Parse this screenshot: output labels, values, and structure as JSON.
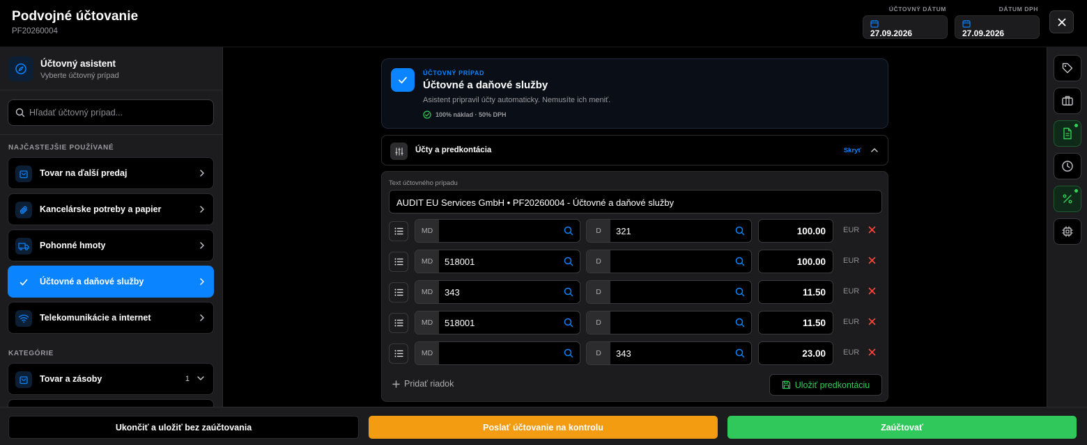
{
  "header": {
    "title": "Podvojné účtovanie",
    "doc_number": "PF20260004",
    "accounting_date_label": "ÚČTOVNÝ DÁTUM",
    "accounting_date": "27.09.2026",
    "vat_date_label": "DÁTUM DPH",
    "vat_date": "27.09.2026"
  },
  "assistant": {
    "title": "Účtovný asistent",
    "subtitle": "Vyberte účtovný prípad",
    "search_placeholder": "Hľadať účtovný prípad..."
  },
  "sidebar": {
    "frequent_label": "NAJČASTEJŠIE POUŽÍVANÉ",
    "frequent_items": [
      {
        "label": "Tovar na ďalší predaj",
        "icon": "shopping-bag-icon"
      },
      {
        "label": "Kancelárske potreby a papier",
        "icon": "paperclip-icon"
      },
      {
        "label": "Pohonné hmoty",
        "icon": "truck-icon"
      },
      {
        "label": "Účtovné a daňové služby",
        "icon": "check-icon",
        "active": true
      },
      {
        "label": "Telekomunikácie a internet",
        "icon": "wifi-icon"
      }
    ],
    "categories_label": "KATEGÓRIE",
    "categories": [
      {
        "label": "Tovar a zásoby",
        "count": "1",
        "icon": "shopping-bag-icon"
      }
    ]
  },
  "case": {
    "overline": "ÚČTOVNÝ PRÍPAD",
    "title": "Účtovné a daňové služby",
    "description": "Asistent pripravil účty automaticky. Nemusíte ich meniť.",
    "badge": "100% náklad · 50% DPH"
  },
  "accounts_section": {
    "title": "Účty a predkontácia",
    "toggle_label": "Skryť"
  },
  "entries": {
    "text_label": "Text účtovného prípadu",
    "text_value": "AUDIT EU Services GmbH • PF20260004 - Účtovné a daňové služby",
    "md_label": "MD",
    "d_label": "D",
    "currency": "EUR",
    "rows": [
      {
        "md": "",
        "d": "321",
        "amount": "100.00"
      },
      {
        "md": "518001",
        "d": "",
        "amount": "100.00"
      },
      {
        "md": "343",
        "d": "",
        "amount": "11.50"
      },
      {
        "md": "518001",
        "d": "",
        "amount": "11.50"
      },
      {
        "md": "",
        "d": "343",
        "amount": "23.00"
      }
    ],
    "add_row_label": "Pridať riadok",
    "save_template_label": "Uložiť predkontáciu"
  },
  "footer": {
    "finish_label": "Ukončiť a uložiť bez zaúčtovania",
    "review_label": "Poslať účtovanie na kontrolu",
    "post_label": "Zaúčtovať"
  },
  "colors": {
    "accent": "#0a84ff",
    "success": "#30d158",
    "danger": "#ff453a",
    "warning": "#f39c12"
  }
}
